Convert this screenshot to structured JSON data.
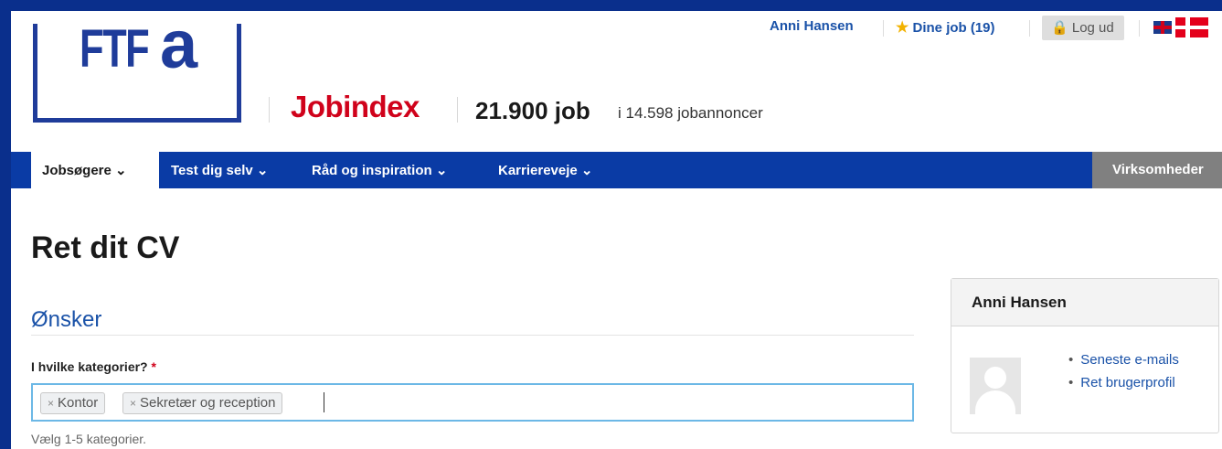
{
  "brand": {
    "logo_text_ftf": "FTF",
    "logo_text_a": "a",
    "site_name": "Jobindex",
    "job_count": "21.900 job",
    "job_count_sub": "i 14.598 jobannoncer"
  },
  "topbar": {
    "user_name": "Anni Hansen",
    "my_jobs": "Dine job (19)",
    "logout": "Log ud"
  },
  "nav": {
    "items": [
      {
        "label": "Jobsøgere ⌄"
      },
      {
        "label": "Test dig selv ⌄"
      },
      {
        "label": "Råd og inspiration ⌄"
      },
      {
        "label": "Karriereveje ⌄"
      }
    ],
    "right": "Virksomheder"
  },
  "page": {
    "title": "Ret dit CV",
    "section": "Ønsker",
    "field_label": "I hvilke kategorier?",
    "required_mark": "*",
    "tags": [
      "Kontor",
      "Sekretær og reception"
    ],
    "tag_remove": "×",
    "hint": "Vælg 1-5 kategorier."
  },
  "profile_card": {
    "name": "Anni Hansen",
    "links": [
      "Seneste e-mails",
      "Ret brugerprofil"
    ]
  },
  "colors": {
    "brand_blue": "#0a3ba5",
    "brand_red": "#d0021b",
    "link_blue": "#1a52a8"
  },
  "icons": [
    "star-icon",
    "lock-icon",
    "flag-uk-icon",
    "flag-dk-icon",
    "avatar-placeholder-icon"
  ]
}
